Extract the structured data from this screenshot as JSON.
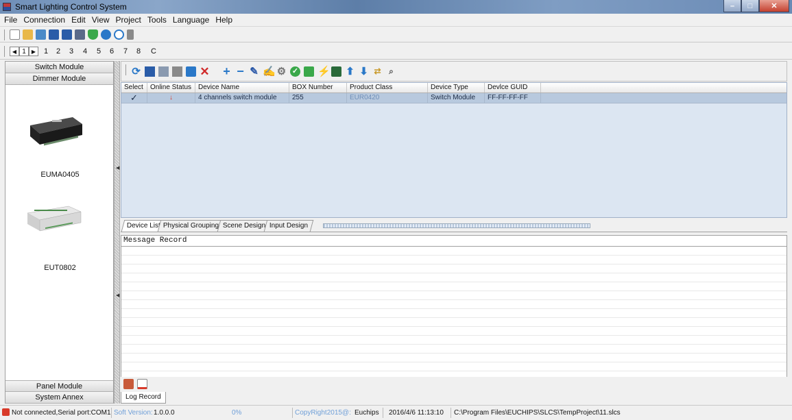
{
  "window": {
    "title": "Smart Lighting Control System"
  },
  "menu": [
    "File",
    "Connection",
    "Edit",
    "View",
    "Project",
    "Tools",
    "Language",
    "Help"
  ],
  "toolbar_icons": [
    "new-icon",
    "open-icon",
    "project-icon",
    "save-icon",
    "save-as-icon",
    "close-project-icon",
    "shield-icon",
    "help-icon",
    "info-icon",
    "exit-icon"
  ],
  "pager": {
    "pages": [
      "1",
      "2",
      "3",
      "4",
      "5",
      "6",
      "7",
      "8",
      "C"
    ]
  },
  "sidebar": {
    "top_buttons": [
      "Switch Module",
      "Dimmer Module"
    ],
    "devices": [
      "EUMA0405",
      "EUT0802"
    ],
    "bottom_buttons": [
      "Panel Module",
      "System Annex"
    ]
  },
  "device_toolbar_icons": [
    "refresh-icon",
    "list-icon",
    "list-icon",
    "list-icon",
    "search-icon",
    "delete-icon",
    "add-icon",
    "remove-icon",
    "edit-icon",
    "write-icon",
    "settings-icon",
    "check-icon",
    "download-icon",
    "flash-icon",
    "chip-icon",
    "arrow-up-icon",
    "arrow-down-icon",
    "transfer-icon",
    "find-icon"
  ],
  "grid": {
    "columns": [
      "Select",
      "Online Status",
      "Device Name",
      "BOX Number",
      "Product Class",
      "Device Type",
      "Devlce GUID"
    ],
    "rows": [
      {
        "select": "✓",
        "online": "↓",
        "name": "4 channels switch module",
        "box": "255",
        "product": "EUR0420",
        "type": "Switch Module",
        "guid": "FF-FF-FF-FF"
      }
    ]
  },
  "tabs": [
    "Device List",
    "Physical Grouping",
    "Scene Design",
    "Input Design"
  ],
  "message_header": "Message Record",
  "log_tab": "Log Record",
  "status": {
    "connection": "Not connected,Serial port:COM1",
    "version_label": "Soft Version:",
    "version": "1.0.0.0",
    "progress": "0%",
    "copyright": "CopyRight2015@:",
    "company": "Euchips",
    "datetime": "2016/4/6 11:13:10",
    "path": "C:\\Program Files\\EUCHIPS\\SLCS\\TempProject\\11.slcs"
  },
  "colors": {
    "accent": "#2a78c8",
    "grid_bg": "#dce6f2",
    "row_selected": "#b8c9de",
    "online_status": "#d83a2a",
    "faded_text": "#6f9fd8"
  }
}
